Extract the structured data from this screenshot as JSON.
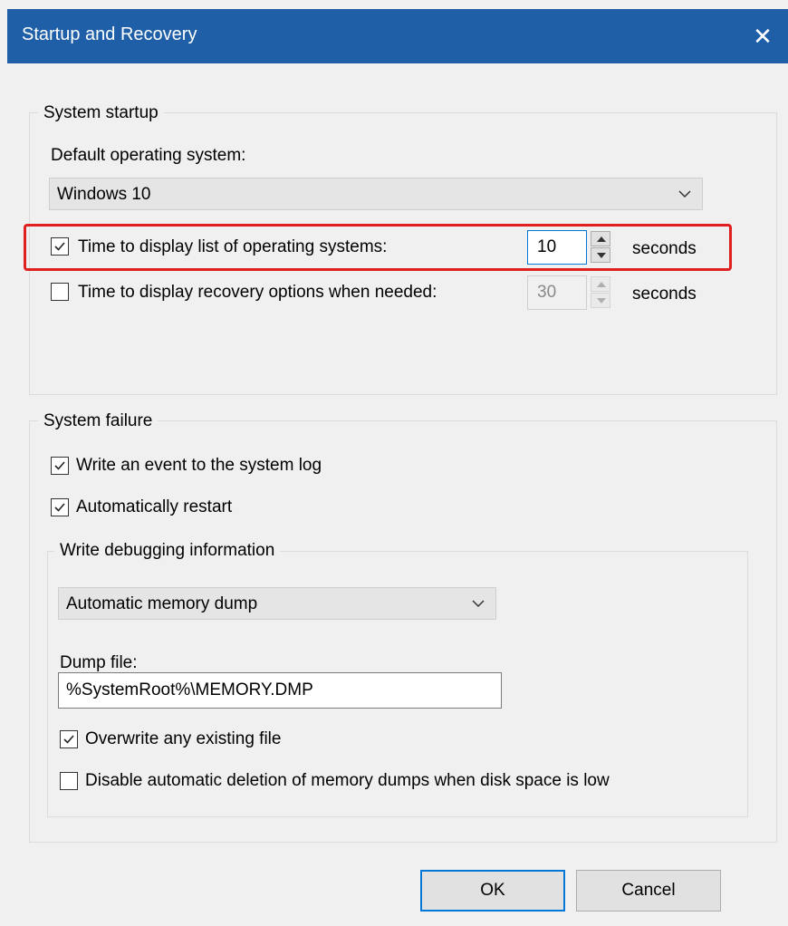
{
  "window": {
    "title": "Startup and Recovery",
    "close_glyph": "✕"
  },
  "system_startup": {
    "legend": "System startup",
    "default_os_label": "Default operating system:",
    "default_os_value": "Windows 10",
    "display_list": {
      "checked": true,
      "label": "Time to display list of operating systems:",
      "value": "10",
      "unit": "seconds"
    },
    "display_recovery": {
      "checked": false,
      "label": "Time to display recovery options when needed:",
      "value": "30",
      "unit": "seconds"
    }
  },
  "system_failure": {
    "legend": "System failure",
    "write_event": {
      "checked": true,
      "label": "Write an event to the system log"
    },
    "auto_restart": {
      "checked": true,
      "label": "Automatically restart"
    },
    "debug": {
      "legend": "Write debugging information",
      "dump_type": "Automatic memory dump",
      "dump_file_label": "Dump file:",
      "dump_file_value": "%SystemRoot%\\MEMORY.DMP",
      "overwrite": {
        "checked": true,
        "label": "Overwrite any existing file"
      },
      "disable_auto_delete": {
        "checked": false,
        "label": "Disable automatic deletion of memory dumps when disk space is low"
      }
    }
  },
  "buttons": {
    "ok": "OK",
    "cancel": "Cancel"
  },
  "colors": {
    "titlebar": "#1f5fa8",
    "highlight": "#e02020",
    "focus": "#0078d7"
  }
}
